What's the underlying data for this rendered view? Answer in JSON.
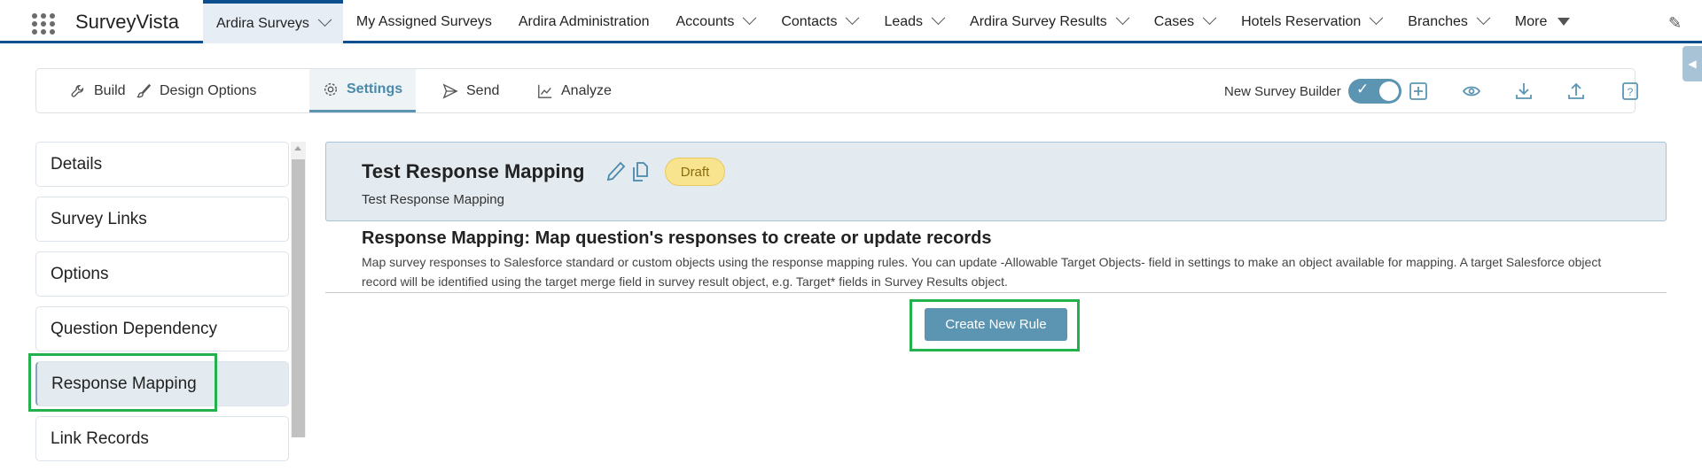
{
  "app": {
    "name": "SurveyVista"
  },
  "nav": {
    "tabs": [
      {
        "label": "Ardira Surveys",
        "dropdown": true,
        "active": true
      },
      {
        "label": "My Assigned Surveys",
        "dropdown": false
      },
      {
        "label": "Ardira Administration",
        "dropdown": false
      },
      {
        "label": "Accounts",
        "dropdown": true
      },
      {
        "label": "Contacts",
        "dropdown": true
      },
      {
        "label": "Leads",
        "dropdown": true
      },
      {
        "label": "Ardira Survey Results",
        "dropdown": true
      },
      {
        "label": "Cases",
        "dropdown": true
      },
      {
        "label": "Hotels Reservation",
        "dropdown": true
      },
      {
        "label": "Branches",
        "dropdown": true
      }
    ],
    "more": "More"
  },
  "toolbar": {
    "tabs": [
      "Build",
      "Design Options",
      "Settings",
      "Send",
      "Analyze"
    ],
    "active": "Settings",
    "new_builder_label": "New Survey Builder",
    "new_builder_on": true
  },
  "sidebar": {
    "items": [
      "Details",
      "Survey Links",
      "Options",
      "Question Dependency",
      "Response Mapping",
      "Link Records"
    ],
    "active": "Response Mapping"
  },
  "survey": {
    "title": "Test Response Mapping",
    "status": "Draft",
    "subtitle": "Test Response Mapping"
  },
  "section": {
    "heading": "Response Mapping: Map question's responses to create or update records",
    "description": "Map survey responses to Salesforce standard or custom objects using the response mapping rules. You can update -Allowable Target Objects- field in settings to make an object available for mapping. A target Salesforce object record will be identified using the target merge field in survey result object, e.g. Target* fields in Survey Results object.",
    "button": "Create New Rule"
  },
  "colors": {
    "brand": "#0b4f8f",
    "accent": "#5c95b2",
    "highlight": "#22b14c",
    "badge": "#f8e38f"
  }
}
